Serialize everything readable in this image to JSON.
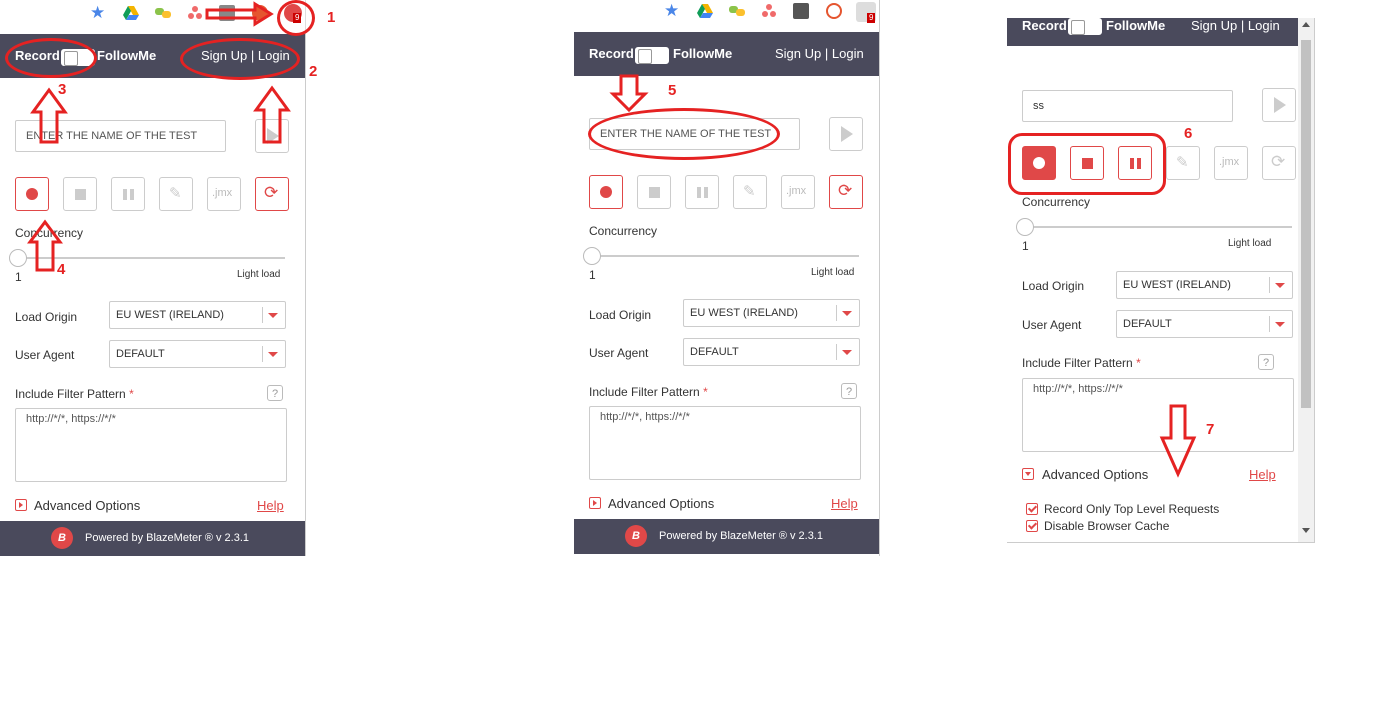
{
  "panels": [
    {
      "header": {
        "record": "Record",
        "followme": "FollowMe",
        "signup": "Sign Up",
        "sep": "|",
        "login": "Login"
      },
      "test_name_placeholder": "ENTER THE NAME OF THE TEST",
      "concurrency_label": "Concurrency",
      "concurrency_value": "1",
      "load_label": "Light load",
      "load_origin_label": "Load Origin",
      "load_origin_value": "EU WEST (IRELAND)",
      "user_agent_label": "User Agent",
      "user_agent_value": "DEFAULT",
      "filter_label": "Include Filter Pattern",
      "required_mark": "*",
      "filter_value": "http://*/*, https://*/*",
      "advanced_label": "Advanced Options",
      "help_label": "Help",
      "footer_text": "Powered by BlazeMeter ® v 2.3.1"
    },
    {
      "header": {
        "record": "Record",
        "followme": "FollowMe",
        "signup": "Sign Up",
        "sep": "|",
        "login": "Login"
      },
      "test_name_placeholder": "ENTER THE NAME OF THE TEST",
      "concurrency_label": "Concurrency",
      "concurrency_value": "1",
      "load_label": "Light load",
      "load_origin_label": "Load Origin",
      "load_origin_value": "EU WEST (IRELAND)",
      "user_agent_label": "User Agent",
      "user_agent_value": "DEFAULT",
      "filter_label": "Include Filter Pattern",
      "required_mark": "*",
      "filter_value": "http://*/*, https://*/*",
      "advanced_label": "Advanced Options",
      "help_label": "Help",
      "footer_text": "Powered by BlazeMeter ® v 2.3.1"
    },
    {
      "header": {
        "record": "Record",
        "followme": "FollowMe",
        "signup": "Sign Up",
        "sep": "|",
        "login": "Login"
      },
      "test_name_value": "ss",
      "concurrency_label": "Concurrency",
      "concurrency_value": "1",
      "load_label": "Light load",
      "load_origin_label": "Load Origin",
      "load_origin_value": "EU WEST (IRELAND)",
      "user_agent_label": "User Agent",
      "user_agent_value": "DEFAULT",
      "filter_label": "Include Filter Pattern",
      "required_mark": "*",
      "filter_value": "http://*/*, https://*/*",
      "advanced_label": "Advanced Options",
      "help_label": "Help",
      "options": [
        "Record Only Top Level Requests",
        "Disable Browser Cache"
      ]
    }
  ],
  "jmx_label": ".jmx",
  "badge_count": "9",
  "annotations": [
    "1",
    "2",
    "3",
    "4",
    "5",
    "6",
    "7"
  ],
  "colors": {
    "header": "#4a4a5c",
    "accent": "#e04848",
    "annotation": "#e52222"
  }
}
